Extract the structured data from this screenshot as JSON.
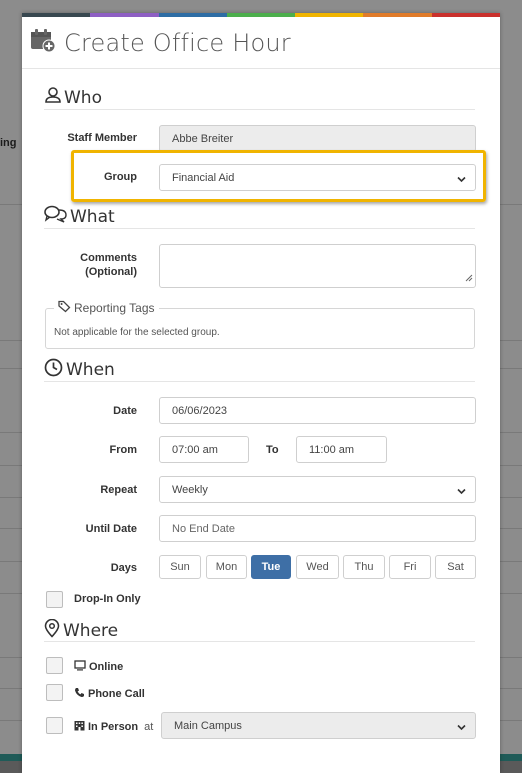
{
  "colors": {
    "color_bar": [
      "#37474f",
      "#8e5fc3",
      "#2e6da4",
      "#4cae4c",
      "#f0b400",
      "#e07b2a",
      "#c9302c"
    ],
    "highlight": "#f0b400",
    "active_day": "#3e6fa6"
  },
  "background": {
    "partial_text": "ing"
  },
  "modal": {
    "title": "Create Office Hour",
    "title_icon": "calendar-plus-icon"
  },
  "who": {
    "heading": "Who",
    "icon": "user-icon",
    "staff_label": "Staff Member",
    "staff_value": "Abbe Breiter",
    "group_label": "Group",
    "group_value": "Financial Aid"
  },
  "what": {
    "heading": "What",
    "icon": "chat-icon",
    "comments_label_1": "Comments",
    "comments_label_2": "(Optional)",
    "comments_value": "",
    "tags_legend": "Reporting Tags",
    "tags_icon": "tag-icon",
    "tags_text": "Not applicable for the selected group."
  },
  "when": {
    "heading": "When",
    "icon": "clock-icon",
    "date_label": "Date",
    "date_value": "06/06/2023",
    "from_label": "From",
    "from_value": "07:00 am",
    "to_label": "To",
    "to_value": "11:00 am",
    "repeat_label": "Repeat",
    "repeat_value": "Weekly",
    "until_label": "Until Date",
    "until_placeholder": "No End Date",
    "days_label": "Days",
    "days": [
      "Sun",
      "Mon",
      "Tue",
      "Wed",
      "Thu",
      "Fri",
      "Sat"
    ],
    "selected_day": "Tue",
    "dropin_label": "Drop-In Only"
  },
  "where": {
    "heading": "Where",
    "icon": "map-pin-icon",
    "online_label": "Online",
    "phone_label": "Phone Call",
    "inperson_label": "In Person",
    "at_label": "at",
    "location_value": "Main Campus"
  }
}
